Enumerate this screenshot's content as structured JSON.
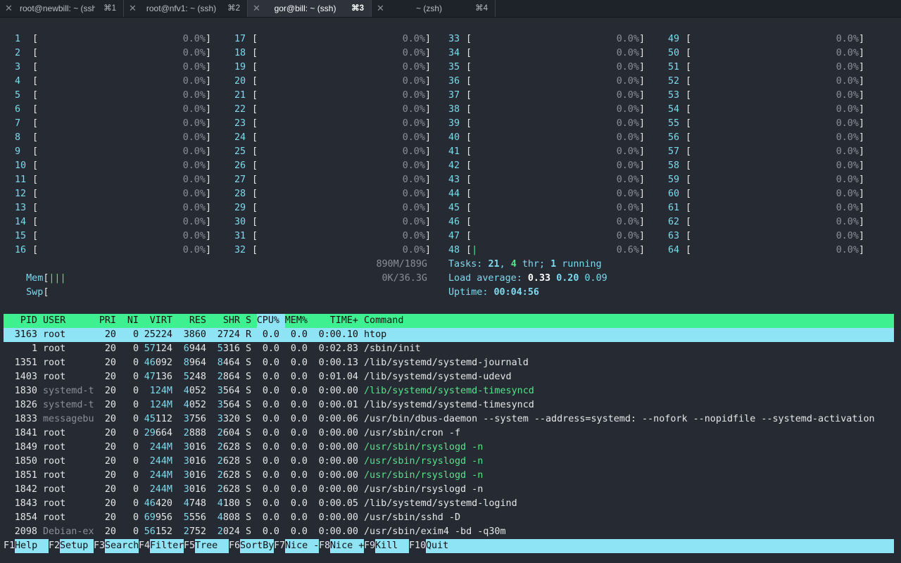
{
  "tabs": [
    {
      "title": "root@newbill: ~ (ssh)",
      "shortcut": "⌘1",
      "active": false
    },
    {
      "title": "root@nfv1: ~ (ssh)",
      "shortcut": "⌘2",
      "active": false
    },
    {
      "title": "gor@bill: ~ (ssh)",
      "shortcut": "⌘3",
      "active": true
    },
    {
      "title": "~ (zsh)",
      "shortcut": "⌘4",
      "active": false
    }
  ],
  "cpus": [
    {
      "id": "1",
      "pct": "0.0%"
    },
    {
      "id": "2",
      "pct": "0.0%"
    },
    {
      "id": "3",
      "pct": "0.0%"
    },
    {
      "id": "4",
      "pct": "0.0%"
    },
    {
      "id": "5",
      "pct": "0.0%"
    },
    {
      "id": "6",
      "pct": "0.0%"
    },
    {
      "id": "7",
      "pct": "0.0%"
    },
    {
      "id": "8",
      "pct": "0.0%"
    },
    {
      "id": "9",
      "pct": "0.0%"
    },
    {
      "id": "10",
      "pct": "0.0%"
    },
    {
      "id": "11",
      "pct": "0.0%"
    },
    {
      "id": "12",
      "pct": "0.0%"
    },
    {
      "id": "13",
      "pct": "0.0%"
    },
    {
      "id": "14",
      "pct": "0.0%"
    },
    {
      "id": "15",
      "pct": "0.0%"
    },
    {
      "id": "16",
      "pct": "0.0%"
    },
    {
      "id": "17",
      "pct": "0.0%"
    },
    {
      "id": "18",
      "pct": "0.0%"
    },
    {
      "id": "19",
      "pct": "0.0%"
    },
    {
      "id": "20",
      "pct": "0.0%"
    },
    {
      "id": "21",
      "pct": "0.0%"
    },
    {
      "id": "22",
      "pct": "0.0%"
    },
    {
      "id": "23",
      "pct": "0.0%"
    },
    {
      "id": "24",
      "pct": "0.0%"
    },
    {
      "id": "25",
      "pct": "0.0%"
    },
    {
      "id": "26",
      "pct": "0.0%"
    },
    {
      "id": "27",
      "pct": "0.0%"
    },
    {
      "id": "28",
      "pct": "0.0%"
    },
    {
      "id": "29",
      "pct": "0.0%"
    },
    {
      "id": "30",
      "pct": "0.0%"
    },
    {
      "id": "31",
      "pct": "0.0%"
    },
    {
      "id": "32",
      "pct": "0.0%"
    },
    {
      "id": "33",
      "pct": "0.0%"
    },
    {
      "id": "34",
      "pct": "0.0%"
    },
    {
      "id": "35",
      "pct": "0.0%"
    },
    {
      "id": "36",
      "pct": "0.0%"
    },
    {
      "id": "37",
      "pct": "0.0%"
    },
    {
      "id": "38",
      "pct": "0.0%"
    },
    {
      "id": "39",
      "pct": "0.0%"
    },
    {
      "id": "40",
      "pct": "0.0%"
    },
    {
      "id": "41",
      "pct": "0.0%"
    },
    {
      "id": "42",
      "pct": "0.0%"
    },
    {
      "id": "43",
      "pct": "0.0%"
    },
    {
      "id": "44",
      "pct": "0.0%"
    },
    {
      "id": "45",
      "pct": "0.0%"
    },
    {
      "id": "46",
      "pct": "0.0%"
    },
    {
      "id": "47",
      "pct": "0.0%"
    },
    {
      "id": "48",
      "pct": "0.6%",
      "bar": "|"
    },
    {
      "id": "49",
      "pct": "0.0%"
    },
    {
      "id": "50",
      "pct": "0.0%"
    },
    {
      "id": "51",
      "pct": "0.0%"
    },
    {
      "id": "52",
      "pct": "0.0%"
    },
    {
      "id": "53",
      "pct": "0.0%"
    },
    {
      "id": "54",
      "pct": "0.0%"
    },
    {
      "id": "55",
      "pct": "0.0%"
    },
    {
      "id": "56",
      "pct": "0.0%"
    },
    {
      "id": "57",
      "pct": "0.0%"
    },
    {
      "id": "58",
      "pct": "0.0%"
    },
    {
      "id": "59",
      "pct": "0.0%"
    },
    {
      "id": "60",
      "pct": "0.0%"
    },
    {
      "id": "61",
      "pct": "0.0%"
    },
    {
      "id": "62",
      "pct": "0.0%"
    },
    {
      "id": "63",
      "pct": "0.0%"
    },
    {
      "id": "64",
      "pct": "0.0%"
    }
  ],
  "meters": {
    "mem": {
      "label": "Mem",
      "bar": "|||",
      "value": "890M/189G"
    },
    "swp": {
      "label": "Swp",
      "bar": "",
      "value": "0K/36.3G"
    }
  },
  "summary": {
    "tasks_label": "Tasks:",
    "tasks": "21",
    "sep1": ",",
    "thr": "4",
    "thr_label": "thr;",
    "running": "1",
    "running_label": "running",
    "load_label": "Load average:",
    "load1": "0.33",
    "load5": "0.20",
    "load15": "0.09",
    "uptime_label": "Uptime:",
    "uptime": "00:04:56"
  },
  "header": {
    "pid": "PID",
    "user": "USER",
    "pri": "PRI",
    "ni": "NI",
    "virt": "VIRT",
    "res": "RES",
    "shr": "SHR",
    "s": "S",
    "cpu": "CPU%",
    "mem": "MEM%",
    "time": "TIME+",
    "command": "Command"
  },
  "processes": [
    {
      "pid": "3163",
      "user": "root",
      "pri": "20",
      "ni": "0",
      "virt": "25224",
      "res": "3860",
      "shr": "2724",
      "s": "R",
      "cpu": "0.0",
      "mem": "0.0",
      "time": "0:00.10",
      "cmd": "htop",
      "selected": true
    },
    {
      "pid": "1",
      "user": "root",
      "pri": "20",
      "ni": "0",
      "virt": "57124",
      "res": "6944",
      "shr": "5316",
      "s": "S",
      "cpu": "0.0",
      "mem": "0.0",
      "time": "0:02.83",
      "cmd": "/sbin/init"
    },
    {
      "pid": "1351",
      "user": "root",
      "pri": "20",
      "ni": "0",
      "virt": "46092",
      "res": "8964",
      "shr": "8464",
      "s": "S",
      "cpu": "0.0",
      "mem": "0.0",
      "time": "0:00.13",
      "cmd": "/lib/systemd/systemd-journald"
    },
    {
      "pid": "1403",
      "user": "root",
      "pri": "20",
      "ni": "0",
      "virt": "47136",
      "res": "5248",
      "shr": "2864",
      "s": "S",
      "cpu": "0.0",
      "mem": "0.0",
      "time": "0:01.04",
      "cmd": "/lib/systemd/systemd-udevd"
    },
    {
      "pid": "1830",
      "user": "systemd-t",
      "pri": "20",
      "ni": "0",
      "virt": "124M",
      "res": "4052",
      "shr": "3564",
      "s": "S",
      "cpu": "0.0",
      "mem": "0.0",
      "time": "0:00.00",
      "cmd": "/lib/systemd/systemd-timesyncd",
      "thread": true,
      "dimuser": true
    },
    {
      "pid": "1826",
      "user": "systemd-t",
      "pri": "20",
      "ni": "0",
      "virt": "124M",
      "res": "4052",
      "shr": "3564",
      "s": "S",
      "cpu": "0.0",
      "mem": "0.0",
      "time": "0:00.01",
      "cmd": "/lib/systemd/systemd-timesyncd",
      "dimuser": true
    },
    {
      "pid": "1833",
      "user": "messagebu",
      "pri": "20",
      "ni": "0",
      "virt": "45112",
      "res": "3756",
      "shr": "3320",
      "s": "S",
      "cpu": "0.0",
      "mem": "0.0",
      "time": "0:00.06",
      "cmd": "/usr/bin/dbus-daemon --system --address=systemd: --nofork --nopidfile --systemd-activation",
      "dimuser": true
    },
    {
      "pid": "1841",
      "user": "root",
      "pri": "20",
      "ni": "0",
      "virt": "29664",
      "res": "2888",
      "shr": "2604",
      "s": "S",
      "cpu": "0.0",
      "mem": "0.0",
      "time": "0:00.00",
      "cmd": "/usr/sbin/cron -f"
    },
    {
      "pid": "1849",
      "user": "root",
      "pri": "20",
      "ni": "0",
      "virt": "244M",
      "res": "3016",
      "shr": "2628",
      "s": "S",
      "cpu": "0.0",
      "mem": "0.0",
      "time": "0:00.00",
      "cmd": "/usr/sbin/rsyslogd -n",
      "thread": true
    },
    {
      "pid": "1850",
      "user": "root",
      "pri": "20",
      "ni": "0",
      "virt": "244M",
      "res": "3016",
      "shr": "2628",
      "s": "S",
      "cpu": "0.0",
      "mem": "0.0",
      "time": "0:00.00",
      "cmd": "/usr/sbin/rsyslogd -n",
      "thread": true
    },
    {
      "pid": "1851",
      "user": "root",
      "pri": "20",
      "ni": "0",
      "virt": "244M",
      "res": "3016",
      "shr": "2628",
      "s": "S",
      "cpu": "0.0",
      "mem": "0.0",
      "time": "0:00.00",
      "cmd": "/usr/sbin/rsyslogd -n",
      "thread": true
    },
    {
      "pid": "1842",
      "user": "root",
      "pri": "20",
      "ni": "0",
      "virt": "244M",
      "res": "3016",
      "shr": "2628",
      "s": "S",
      "cpu": "0.0",
      "mem": "0.0",
      "time": "0:00.00",
      "cmd": "/usr/sbin/rsyslogd -n"
    },
    {
      "pid": "1843",
      "user": "root",
      "pri": "20",
      "ni": "0",
      "virt": "46420",
      "res": "4748",
      "shr": "4180",
      "s": "S",
      "cpu": "0.0",
      "mem": "0.0",
      "time": "0:00.05",
      "cmd": "/lib/systemd/systemd-logind"
    },
    {
      "pid": "1854",
      "user": "root",
      "pri": "20",
      "ni": "0",
      "virt": "69956",
      "res": "5556",
      "shr": "4808",
      "s": "S",
      "cpu": "0.0",
      "mem": "0.0",
      "time": "0:00.00",
      "cmd": "/usr/sbin/sshd -D"
    },
    {
      "pid": "2098",
      "user": "Debian-ex",
      "pri": "20",
      "ni": "0",
      "virt": "56152",
      "res": "2752",
      "shr": "2024",
      "s": "S",
      "cpu": "0.0",
      "mem": "0.0",
      "time": "0:00.00",
      "cmd": "/usr/sbin/exim4 -bd -q30m",
      "dimuser": true
    }
  ],
  "fkeys": [
    {
      "key": "F1",
      "label": "Help"
    },
    {
      "key": "F2",
      "label": "Setup"
    },
    {
      "key": "F3",
      "label": "Search"
    },
    {
      "key": "F4",
      "label": "Filter"
    },
    {
      "key": "F5",
      "label": "Tree"
    },
    {
      "key": "F6",
      "label": "SortBy"
    },
    {
      "key": "F7",
      "label": "Nice -"
    },
    {
      "key": "F8",
      "label": "Nice +"
    },
    {
      "key": "F9",
      "label": "Kill"
    },
    {
      "key": "F10",
      "label": "Quit"
    }
  ],
  "colors": {
    "bg": "#252a33",
    "cyan": "#7fdaf0",
    "green": "#57e389",
    "header": "#3ef08f",
    "selection": "#8ee3f4",
    "dim": "#8a8f98"
  }
}
